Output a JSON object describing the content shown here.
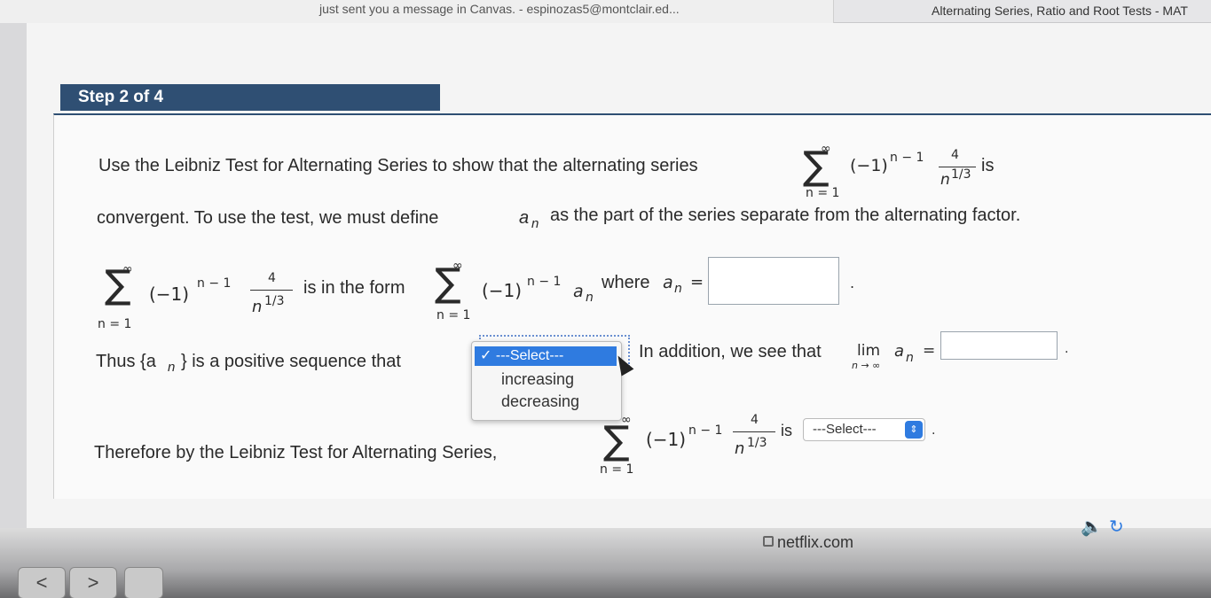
{
  "banner": {
    "notification": "just sent you a message in Canvas. - espinozas5@montclair.ed...",
    "tab_title": "Alternating Series, Ratio and Root Tests - MAT"
  },
  "step": {
    "label": "Step 2 of 4"
  },
  "problem": {
    "line1": "Use the Leibniz Test for Alternating Series to show that the alternating series",
    "line1_tail": "is",
    "line2": "convergent. To use the test, we must define",
    "line2_var": "a",
    "line2_sub": "n",
    "line2_tail": "as the part of the series separate from the alternating factor."
  },
  "series": {
    "upper": "∞",
    "lower": "n = 1",
    "factor": "(−1)",
    "exp": "n − 1",
    "numerator": "4",
    "denominator_base": "n",
    "denominator_exp": "1/3"
  },
  "row2": {
    "is_in_form": "is in the form",
    "an": "a",
    "an_sub": "n",
    "where": "where",
    "eq": "=",
    "period": "."
  },
  "row3": {
    "thus": "Thus {a",
    "thus_sub": "n",
    "thus_tail": "} is a positive sequence that",
    "addition": "In addition, we see that",
    "lim": "lim",
    "lim_sub": "n → ∞",
    "lim_var": "a",
    "lim_var_sub": "n",
    "eq": "=",
    "period": "."
  },
  "dropdown1": {
    "check": "✓",
    "selected": "---Select---",
    "options": [
      "increasing",
      "decreasing"
    ]
  },
  "row4": {
    "therefore": "Therefore by the Leibniz Test for Alternating Series,",
    "is": "is",
    "period": "."
  },
  "dropdown2": {
    "selected": "---Select---",
    "chevron": "⇕"
  },
  "browser": {
    "url": "netflix.com",
    "back": "<",
    "forward": ">",
    "sound_icon": "🔈",
    "reload_icon": "↻"
  }
}
